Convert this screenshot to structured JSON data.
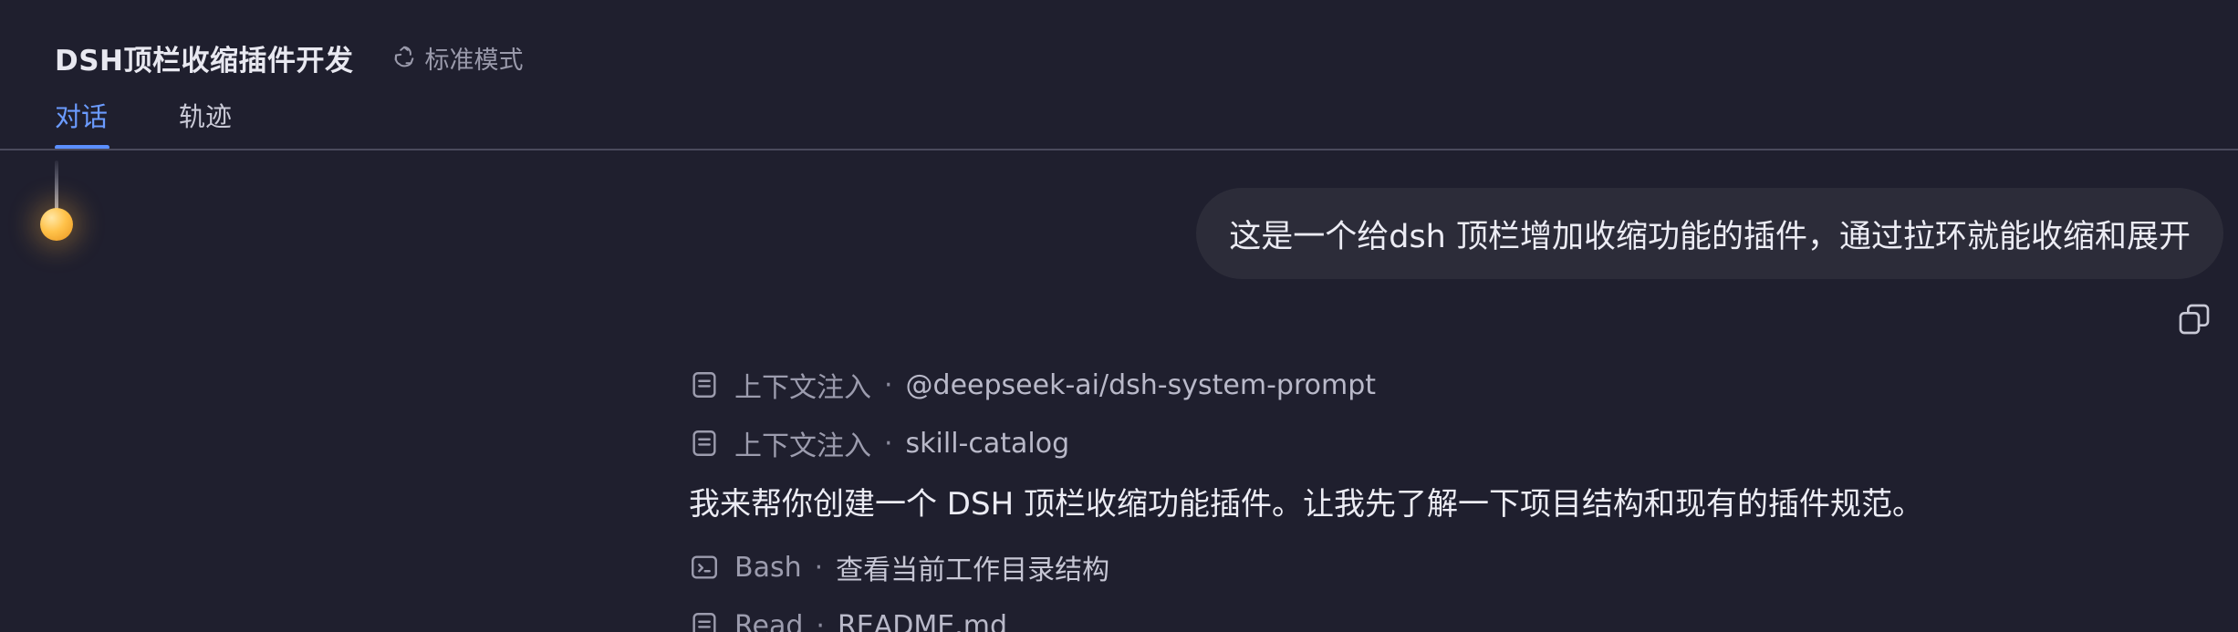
{
  "header": {
    "title": "DSH顶栏收缩插件开发",
    "mode_label": "标准模式",
    "mode_icon": "recycle-icon"
  },
  "tabs": [
    {
      "label": "对话",
      "active": true
    },
    {
      "label": "轨迹",
      "active": false
    }
  ],
  "pull_ring": {
    "icon": "pull-cord-knob"
  },
  "conversation": {
    "user_message": "这是一个给dsh 顶栏增加收缩功能的插件，通过拉环就能收缩和展开",
    "copy_icon": "copy-icon",
    "steps_before": [
      {
        "icon": "document-icon",
        "kind": "上下文注入",
        "target": "@deepseek-ai/dsh-system-prompt"
      },
      {
        "icon": "document-icon",
        "kind": "上下文注入",
        "target": "skill-catalog"
      }
    ],
    "assistant_reply": "我来帮你创建一个 DSH 顶栏收缩功能插件。让我先了解一下项目结构和现有的插件规范。",
    "steps_after": [
      {
        "icon": "terminal-icon",
        "kind": "Bash",
        "target": "查看当前工作目录结构"
      },
      {
        "icon": "document-icon",
        "kind": "Read",
        "target": "README.md"
      }
    ]
  },
  "colors": {
    "background": "#1f1f2e",
    "accent": "#5b8fff",
    "bubble": "#2c2c39",
    "knob": "#ffc24a"
  }
}
